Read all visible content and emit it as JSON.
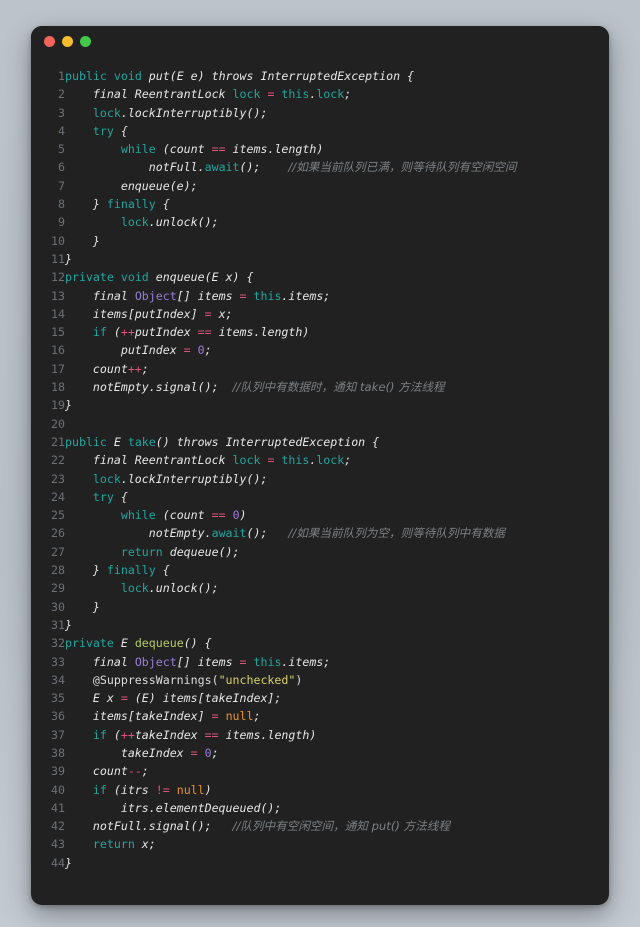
{
  "window": {
    "chrome_dots": [
      {
        "name": "close-dot",
        "color": "#f4645a"
      },
      {
        "name": "minimize-dot",
        "color": "#f5bd30"
      },
      {
        "name": "maximize-dot",
        "color": "#43c74a"
      }
    ],
    "background_color": "#212121",
    "page_background_color": "#b9c1c9"
  },
  "editor": {
    "language": "java",
    "first_line": 1,
    "last_line": 44,
    "gutter_color": "#6d7176",
    "lines": [
      {
        "n": "1",
        "text": "public void put(E e) throws InterruptedException {"
      },
      {
        "n": "2",
        "text": "    final ReentrantLock lock = this.lock;"
      },
      {
        "n": "3",
        "text": "    lock.lockInterruptibly();"
      },
      {
        "n": "4",
        "text": "    try {"
      },
      {
        "n": "5",
        "text": "        while (count == items.length)"
      },
      {
        "n": "6",
        "text": "            notFull.await();    //如果当前队列已满，则等待队列有空闲空间"
      },
      {
        "n": "7",
        "text": "        enqueue(e);"
      },
      {
        "n": "8",
        "text": "    } finally {"
      },
      {
        "n": "9",
        "text": "        lock.unlock();"
      },
      {
        "n": "10",
        "text": "    }"
      },
      {
        "n": "11",
        "text": "}"
      },
      {
        "n": "12",
        "text": "private void enqueue(E x) {"
      },
      {
        "n": "13",
        "text": "    final Object[] items = this.items;"
      },
      {
        "n": "14",
        "text": "    items[putIndex] = x;"
      },
      {
        "n": "15",
        "text": "    if (++putIndex == items.length)"
      },
      {
        "n": "16",
        "text": "        putIndex = 0;"
      },
      {
        "n": "17",
        "text": "    count++;"
      },
      {
        "n": "18",
        "text": "    notEmpty.signal();  //队列中有数据时，通知 take() 方法线程"
      },
      {
        "n": "19",
        "text": "}"
      },
      {
        "n": "20",
        "text": ""
      },
      {
        "n": "21",
        "text": "public E take() throws InterruptedException {"
      },
      {
        "n": "22",
        "text": "    final ReentrantLock lock = this.lock;"
      },
      {
        "n": "23",
        "text": "    lock.lockInterruptibly();"
      },
      {
        "n": "24",
        "text": "    try {"
      },
      {
        "n": "25",
        "text": "        while (count == 0)"
      },
      {
        "n": "26",
        "text": "            notEmpty.await();   //如果当前队列为空，则等待队列中有数据"
      },
      {
        "n": "27",
        "text": "        return dequeue();"
      },
      {
        "n": "28",
        "text": "    } finally {"
      },
      {
        "n": "29",
        "text": "        lock.unlock();"
      },
      {
        "n": "30",
        "text": "    }"
      },
      {
        "n": "31",
        "text": "}"
      },
      {
        "n": "32",
        "text": "private E dequeue() {"
      },
      {
        "n": "33",
        "text": "    final Object[] items = this.items;"
      },
      {
        "n": "34",
        "text": "    @SuppressWarnings(\"unchecked\")"
      },
      {
        "n": "35",
        "text": "    E x = (E) items[takeIndex];"
      },
      {
        "n": "36",
        "text": "    items[takeIndex] = null;"
      },
      {
        "n": "37",
        "text": "    if (++takeIndex == items.length)"
      },
      {
        "n": "38",
        "text": "        takeIndex = 0;"
      },
      {
        "n": "39",
        "text": "    count--;"
      },
      {
        "n": "40",
        "text": "    if (itrs != null)"
      },
      {
        "n": "41",
        "text": "        itrs.elementDequeued();"
      },
      {
        "n": "42",
        "text": "    notFull.signal();   //队列中有空闲空间，通知 put() 方法线程"
      },
      {
        "n": "43",
        "text": "    return x;"
      },
      {
        "n": "44",
        "text": "}"
      }
    ],
    "tokens": {
      "keyword_color": "#1fa6a0",
      "identifier_color": "#e6e6e6",
      "type_color": "#9a7fd4",
      "operator_color": "#e0527a",
      "number_color": "#a37ae0",
      "string_color": "#dbd16a",
      "literal_color": "#e8912d",
      "declaration_color": "#b5cc5a",
      "comment_color": "#7c8084"
    },
    "comments": [
      "//如果当前队列已满，则等待队列有空闲空间",
      "//队列中有数据时，通知 take() 方法线程",
      "//如果当前队列为空，则等待队列中有数据",
      "//队列中有空闲空间，通知 put() 方法线程"
    ]
  }
}
